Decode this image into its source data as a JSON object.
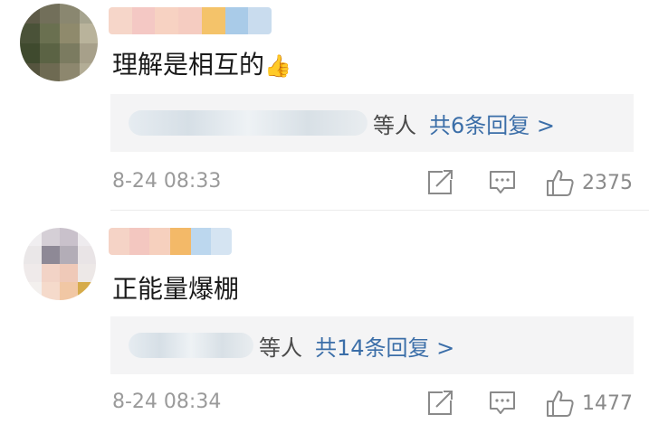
{
  "comments": [
    {
      "text": "理解是相互的",
      "emoji": "👍",
      "reply_suffix": "等人",
      "reply_link": "共6条回复 >",
      "timestamp": "8-24 08:33",
      "likes": "2375",
      "username_colors": [
        "#f6d6c9",
        "#f4c8c4",
        "#f7d2c2",
        "#f5ccc1",
        "#f4c36a",
        "#a9cbe8",
        "#c9dcee"
      ]
    },
    {
      "text": "正能量爆棚",
      "emoji": "",
      "reply_suffix": "等人",
      "reply_link": "共14条回复 >",
      "timestamp": "8-24 08:34",
      "likes": "1477",
      "username_colors": [
        "#f5d3c6",
        "#f3c7c0",
        "#f6d0be",
        "#f3b968",
        "#bcd7ee",
        "#d5e4f2"
      ]
    }
  ],
  "icons": {
    "share": "share-icon",
    "comment": "comment-icon",
    "like": "like-icon"
  }
}
